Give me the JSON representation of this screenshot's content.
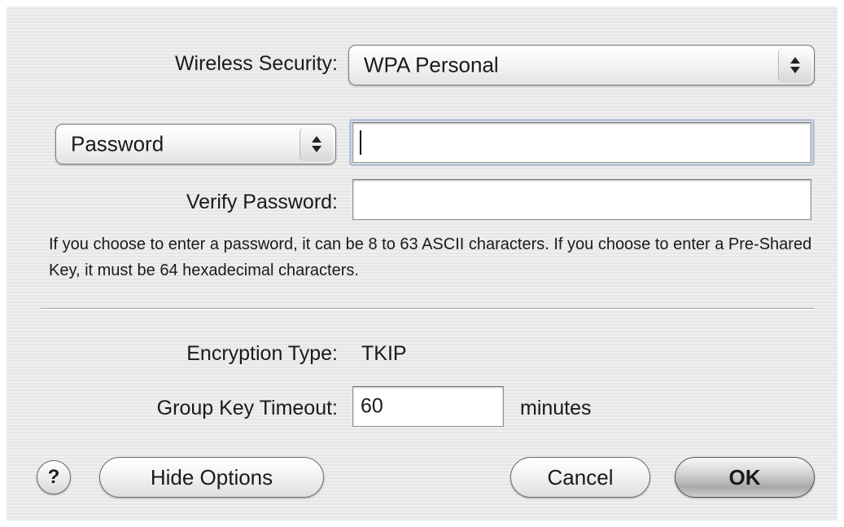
{
  "security": {
    "label": "Wireless Security:",
    "selected": "WPA Personal"
  },
  "password": {
    "type_selected": "Password",
    "value": "",
    "verify_label": "Verify Password:",
    "verify_value": ""
  },
  "info_text": "If you choose to enter a password, it can be 8 to 63 ASCII characters. If you choose to enter a Pre-Shared Key, it must be 64 hexadecimal characters.",
  "encryption": {
    "label": "Encryption Type:",
    "value": "TKIP"
  },
  "group_key": {
    "label": "Group Key Timeout:",
    "value": "60",
    "unit": "minutes"
  },
  "buttons": {
    "help": "?",
    "hide_options": "Hide Options",
    "cancel": "Cancel",
    "ok": "OK"
  },
  "icons": {
    "popup_arrows": "up-down-arrows-icon",
    "help": "question-mark-icon"
  },
  "colors": {
    "dialog_background": "#ececec",
    "focus_ring": "#b6c3d6"
  }
}
